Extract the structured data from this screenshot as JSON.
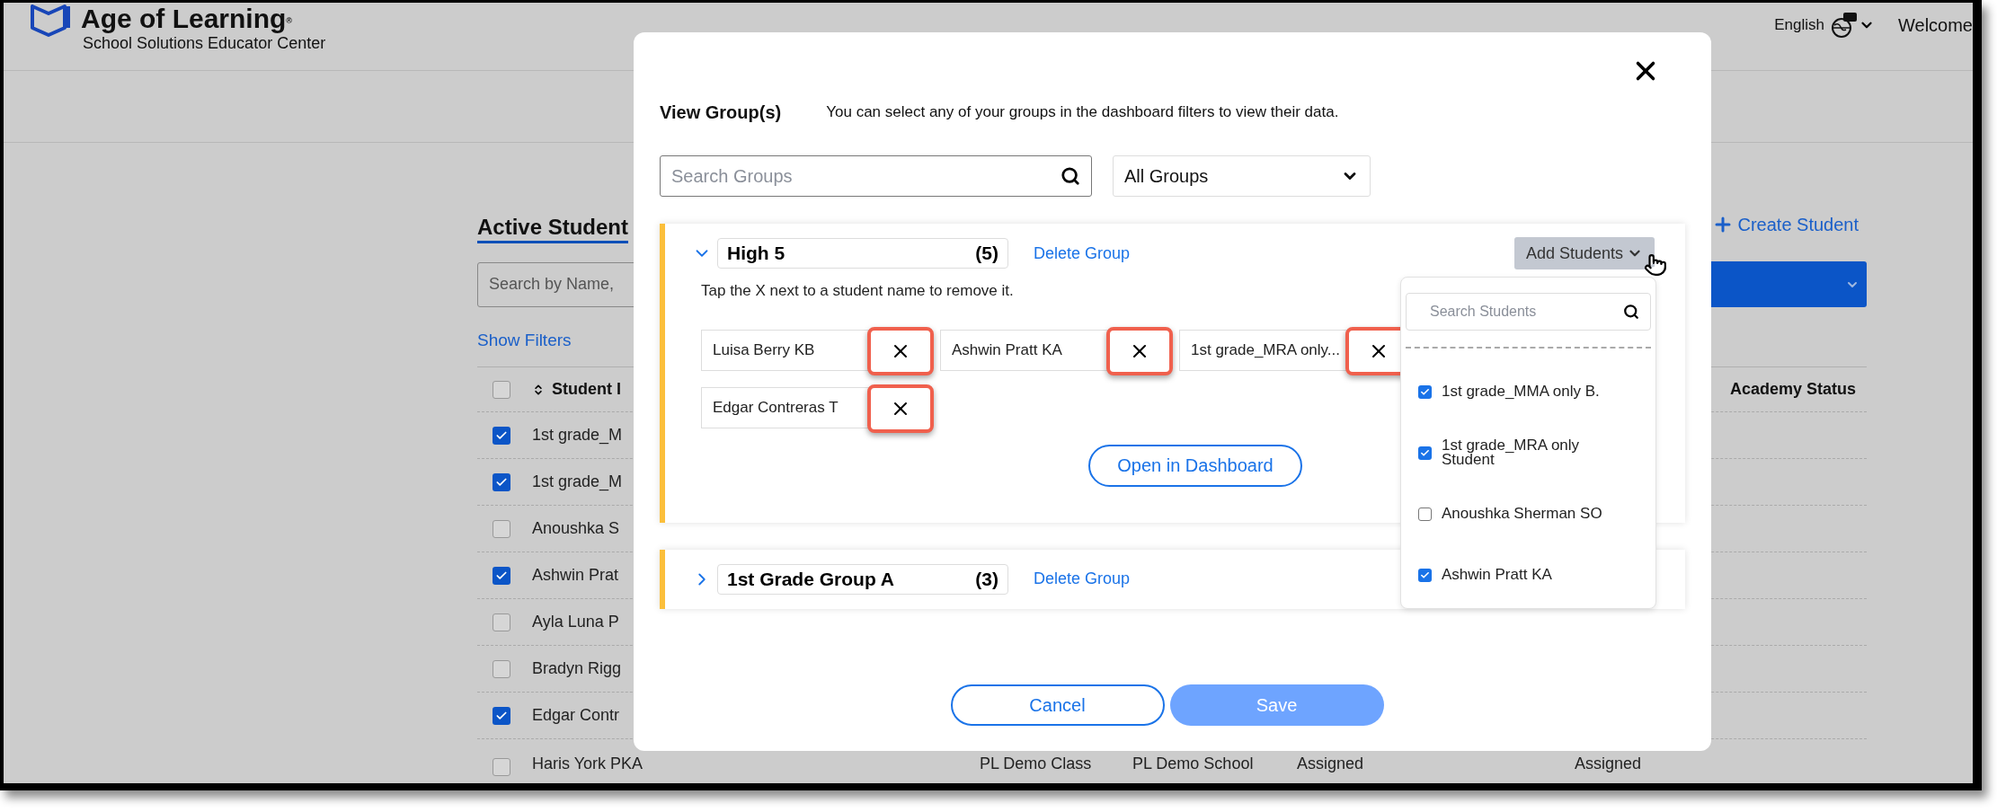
{
  "header": {
    "brand": "Age of Learning",
    "brand_mark": "®",
    "subtitle": "School Solutions Educator Center",
    "language": "English",
    "welcome": "Welcome"
  },
  "students_page": {
    "title": "Active Student",
    "search": {
      "placeholder": "Search by Name,"
    },
    "show_filters": "Show Filters",
    "create_student": "Create Student",
    "select_all_checked": false,
    "columns": [
      "Student I",
      "Academy Status"
    ],
    "rows": [
      {
        "name": "1st grade_M",
        "checked": true
      },
      {
        "name": "1st grade_M",
        "checked": true
      },
      {
        "name": "Anoushka S",
        "checked": false
      },
      {
        "name": "Ashwin Prat",
        "checked": true
      },
      {
        "name": "Ayla Luna P",
        "checked": false
      },
      {
        "name": "Bradyn Rigg",
        "checked": false
      },
      {
        "name": "Edgar Contr",
        "checked": true
      },
      {
        "name": "Haris York PKA",
        "checked": false,
        "cells": [
          "PL Demo Class",
          "PL Demo School",
          "Assigned",
          "Assigned"
        ]
      }
    ]
  },
  "dialog": {
    "title": "View Group(s)",
    "description": "You can select any of your groups in the dashboard filters to view their data.",
    "search": {
      "placeholder": "Search Groups"
    },
    "filter": {
      "value": "All Groups"
    },
    "groups": [
      {
        "name": "High 5",
        "count": "(5)",
        "expanded": true,
        "delete": "Delete Group",
        "add_button": "Add Students",
        "hint": "Tap the X next to a student name to remove it.",
        "students": [
          "Luisa Berry KB",
          "Ashwin Pratt KA",
          "1st grade_MRA only...",
          "Edgar Contreras T"
        ],
        "open_button": "Open in Dashboard"
      },
      {
        "name": "1st Grade Group A",
        "count": "(3)",
        "expanded": false,
        "delete": "Delete Group"
      }
    ],
    "add_students_menu": {
      "search": {
        "placeholder": "Search Students"
      },
      "items": [
        {
          "label": "1st grade_MMA only B.",
          "checked": true
        },
        {
          "label": "1st grade_MRA only Student",
          "checked": true
        },
        {
          "label": "Anoushka Sherman SO",
          "checked": false
        },
        {
          "label": "Ashwin Pratt KA",
          "checked": true
        }
      ]
    },
    "cancel": "Cancel",
    "save": "Save",
    "save_disabled": true
  }
}
